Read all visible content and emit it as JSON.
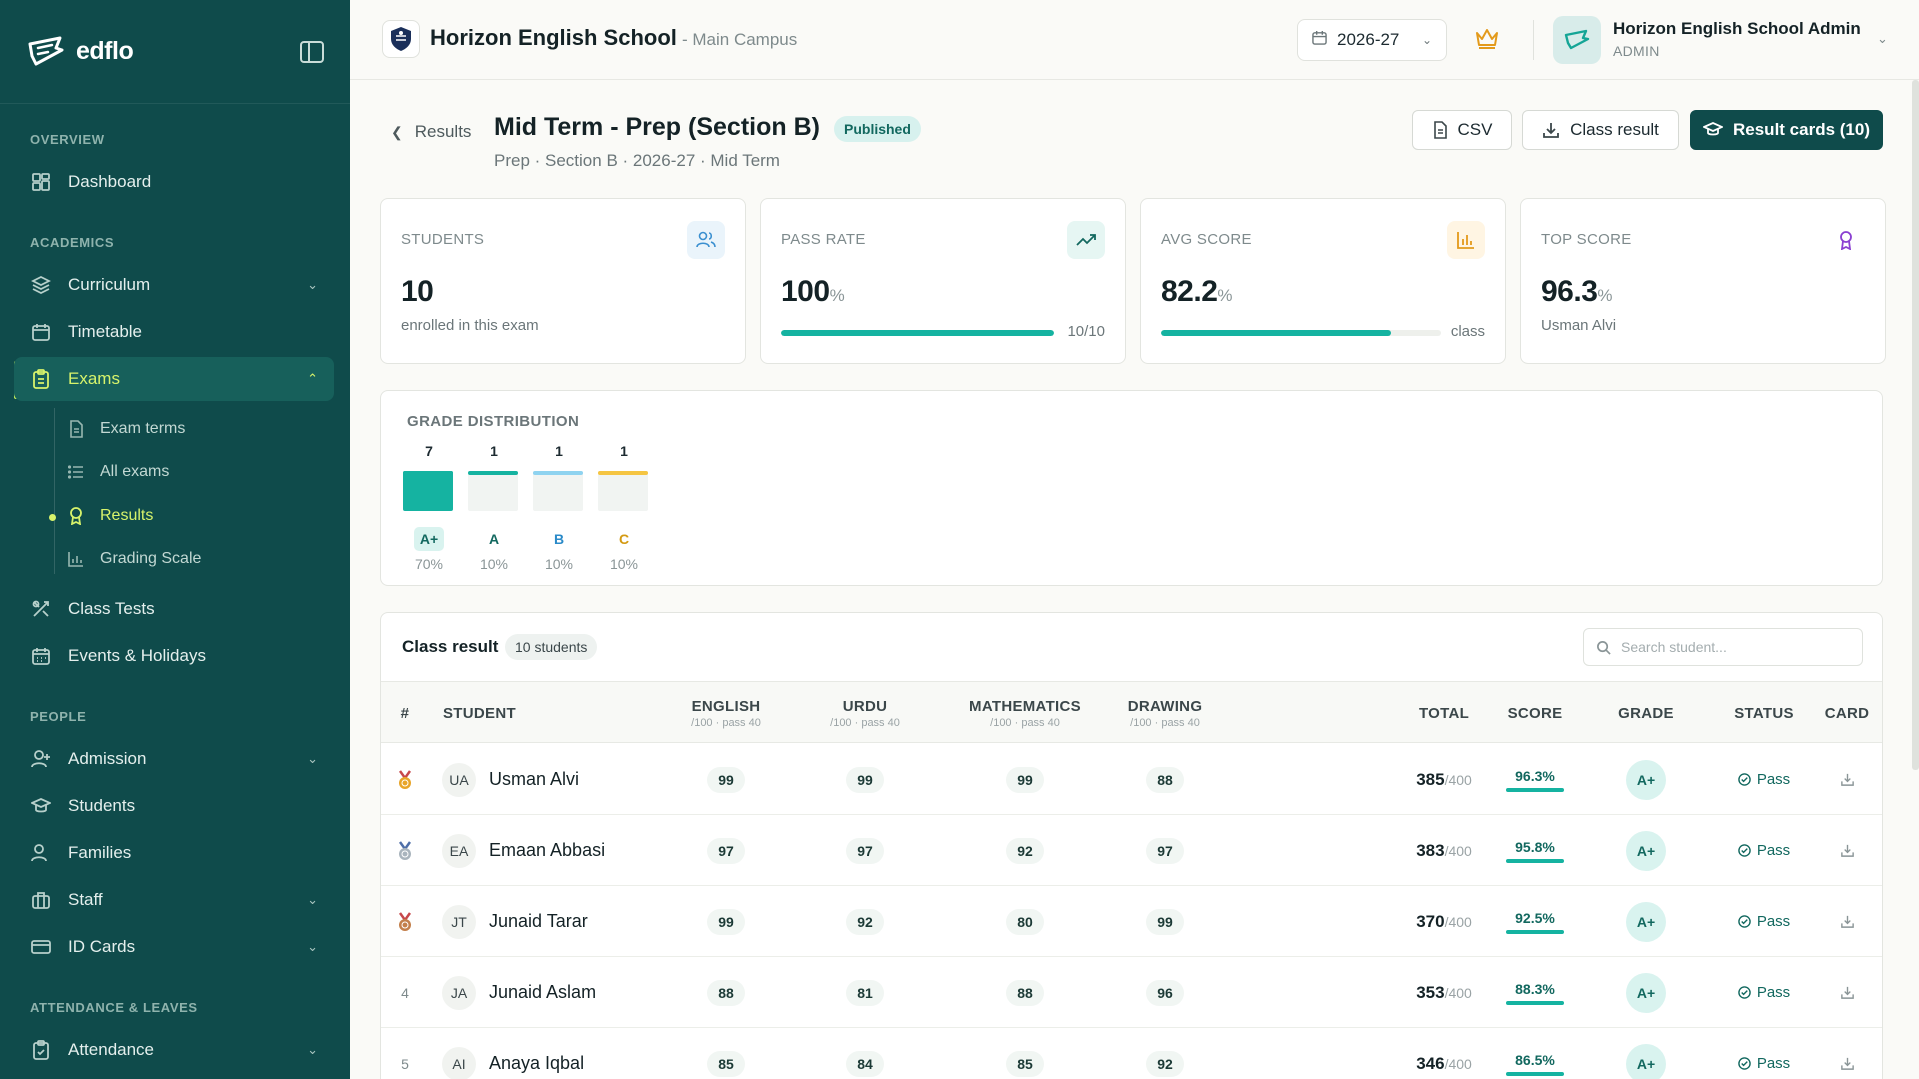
{
  "brand": {
    "name": "edflo"
  },
  "sidebar": {
    "sections": [
      "OVERVIEW",
      "ACADEMICS",
      "PEOPLE",
      "ATTENDANCE & LEAVES"
    ],
    "items": [
      {
        "label": "Dashboard",
        "icon": "grid-icon"
      },
      {
        "label": "Curriculum",
        "icon": "layers-icon"
      },
      {
        "label": "Timetable",
        "icon": "calendar-icon"
      },
      {
        "label": "Exams",
        "icon": "clipboard-icon"
      },
      {
        "label": "Class Tests",
        "icon": "tools-icon"
      },
      {
        "label": "Events & Holidays",
        "icon": "calendar-days-icon"
      },
      {
        "label": "Admission",
        "icon": "user-plus-icon"
      },
      {
        "label": "Students",
        "icon": "graduation-cap-icon"
      },
      {
        "label": "Families",
        "icon": "users-icon"
      },
      {
        "label": "Staff",
        "icon": "briefcase-icon"
      },
      {
        "label": "ID Cards",
        "icon": "id-card-icon"
      },
      {
        "label": "Attendance",
        "icon": "clipboard-check-icon"
      }
    ],
    "exam_sub": [
      {
        "label": "Exam terms"
      },
      {
        "label": "All exams"
      },
      {
        "label": "Results"
      },
      {
        "label": "Grading Scale"
      }
    ]
  },
  "header": {
    "school_name": "Horizon English School",
    "campus": "- Main Campus",
    "year": "2026-27",
    "admin_name": "Horizon English School Admin",
    "admin_role": "ADMIN"
  },
  "page": {
    "back_label": "Results",
    "title": "Mid Term - Prep (Section B)",
    "status": "Published",
    "subtitle": "Prep · Section B · 2026-27 · Mid Term",
    "buttons": {
      "csv": "CSV",
      "class_result": "Class result",
      "result_cards": "Result cards (10)"
    }
  },
  "stats": {
    "students": {
      "label": "STUDENTS",
      "value": "10",
      "note": "enrolled in this exam"
    },
    "pass_rate": {
      "label": "PASS RATE",
      "value": "100",
      "unit": "%",
      "right": "10/10",
      "fill": 1.0
    },
    "avg_score": {
      "label": "AVG SCORE",
      "value": "82.2",
      "unit": "%",
      "right": "class",
      "fill": 0.822
    },
    "top_score": {
      "label": "TOP SCORE",
      "value": "96.3",
      "unit": "%",
      "note": "Usman Alvi"
    }
  },
  "grades": {
    "title": "GRADE DISTRIBUTION",
    "items": [
      {
        "count": "7",
        "letter": "A+",
        "pct": "70%",
        "color": "#15b3a1"
      },
      {
        "count": "1",
        "letter": "A",
        "pct": "10%",
        "color": "#15b3a1"
      },
      {
        "count": "1",
        "letter": "B",
        "pct": "10%",
        "color": "#8fd3f0"
      },
      {
        "count": "1",
        "letter": "C",
        "pct": "10%",
        "color": "#f5c542"
      }
    ]
  },
  "table": {
    "title": "Class result",
    "count": "10 students",
    "search_placeholder": "Search student...",
    "headers": {
      "rank": "#",
      "student": "STUDENT",
      "english": "ENGLISH",
      "english_sub": "/100 · pass 40",
      "urdu": "URDU",
      "urdu_sub": "/100 · pass 40",
      "math": "MATHEMATICS",
      "math_sub": "/100 · pass 40",
      "drawing": "DRAWING",
      "drawing_sub": "/100 · pass 40",
      "total": "TOTAL",
      "score": "SCORE",
      "grade": "GRADE",
      "status": "STATUS",
      "card": "CARD"
    },
    "rows": [
      {
        "rank": "",
        "medal": "gold",
        "initials": "UA",
        "name": "Usman Alvi",
        "english": "99",
        "urdu": "99",
        "math": "99",
        "drawing": "88",
        "total": "385",
        "of": "/400",
        "score": "96.3%",
        "grade": "A+",
        "status": "Pass"
      },
      {
        "rank": "",
        "medal": "silver",
        "initials": "EA",
        "name": "Emaan Abbasi",
        "english": "97",
        "urdu": "97",
        "math": "92",
        "drawing": "97",
        "total": "383",
        "of": "/400",
        "score": "95.8%",
        "grade": "A+",
        "status": "Pass"
      },
      {
        "rank": "",
        "medal": "bronze",
        "initials": "JT",
        "name": "Junaid Tarar",
        "english": "99",
        "urdu": "92",
        "math": "80",
        "drawing": "99",
        "total": "370",
        "of": "/400",
        "score": "92.5%",
        "grade": "A+",
        "status": "Pass"
      },
      {
        "rank": "4",
        "medal": "",
        "initials": "JA",
        "name": "Junaid Aslam",
        "english": "88",
        "urdu": "81",
        "math": "88",
        "drawing": "96",
        "total": "353",
        "of": "/400",
        "score": "88.3%",
        "grade": "A+",
        "status": "Pass"
      },
      {
        "rank": "5",
        "medal": "",
        "initials": "AI",
        "name": "Anaya Iqbal",
        "english": "85",
        "urdu": "84",
        "math": "85",
        "drawing": "92",
        "total": "346",
        "of": "/400",
        "score": "86.5%",
        "grade": "A+",
        "status": "Pass"
      }
    ]
  }
}
